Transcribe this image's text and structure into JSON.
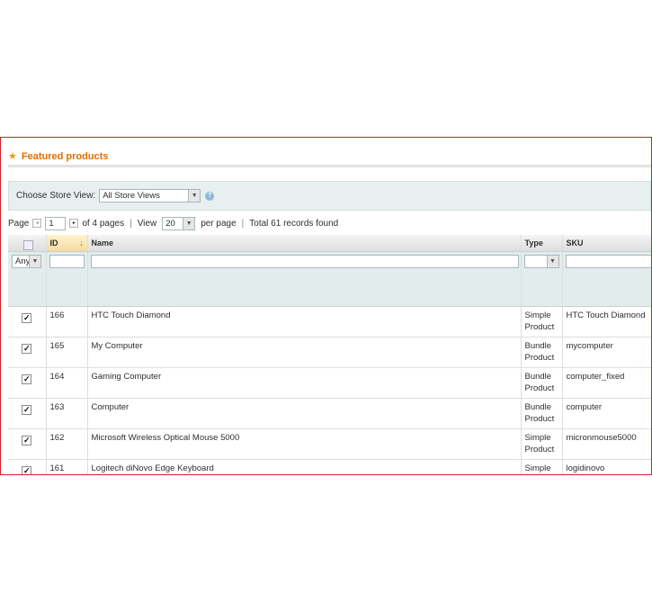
{
  "section": {
    "title": "Featured products",
    "star_icon": "star-icon"
  },
  "store": {
    "label": "Choose Store View:",
    "value": "All Store Views"
  },
  "pager": {
    "page_label": "Page",
    "page_value": "1",
    "of_pages": "of 4 pages",
    "view_label": "View",
    "per_page_value": "20",
    "per_page_label": "per page",
    "total": "Total 61 records found"
  },
  "columns": {
    "id": "ID",
    "name": "Name",
    "type": "Type",
    "sku": "SKU"
  },
  "filter": {
    "in_products": "Any"
  },
  "rows": [
    {
      "checked": true,
      "id": "166",
      "name": "HTC Touch Diamond",
      "type": "Simple Product",
      "sku": "HTC Touch Diamond"
    },
    {
      "checked": true,
      "id": "165",
      "name": "My Computer",
      "type": "Bundle Product",
      "sku": "mycomputer"
    },
    {
      "checked": true,
      "id": "164",
      "name": "Gaming Computer",
      "type": "Bundle Product",
      "sku": "computer_fixed"
    },
    {
      "checked": true,
      "id": "163",
      "name": "Computer",
      "type": "Bundle Product",
      "sku": "computer"
    },
    {
      "checked": true,
      "id": "162",
      "name": "Microsoft Wireless Optical Mouse 5000",
      "type": "Simple Product",
      "sku": "micronmouse5000"
    },
    {
      "checked": true,
      "id": "161",
      "name": "Logitech diNovo Edge Keyboard",
      "type": "Simple Product",
      "sku": "logidinovo"
    }
  ],
  "colors": {
    "frame": "#d31f2a",
    "title": "#e36e00",
    "filter_bg": "#e3ecec"
  }
}
